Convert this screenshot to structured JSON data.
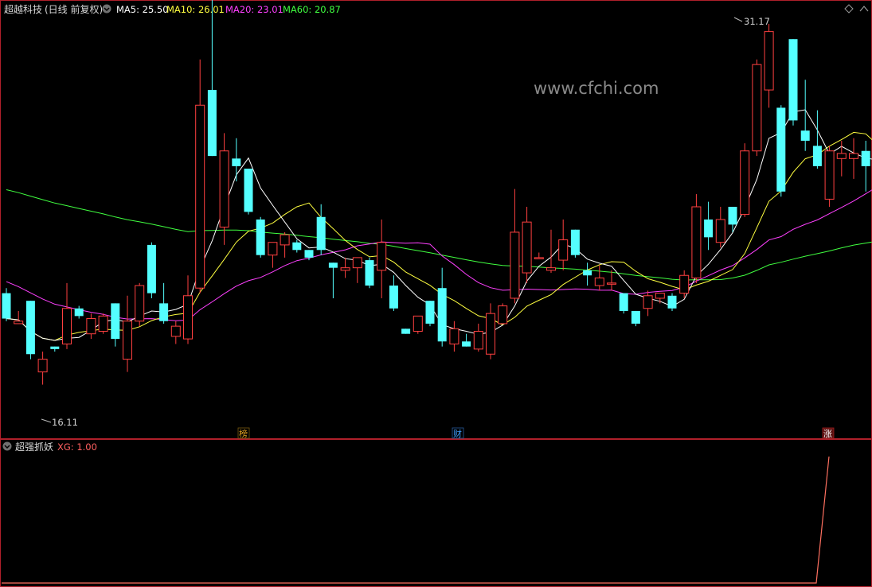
{
  "main_panel": {
    "stock_name": "超越科技",
    "period_label": "(日线 前复权)",
    "indicators": [
      {
        "label": "MA5: 25.50",
        "color": "#ffffff"
      },
      {
        "label": "MA10: 26.01",
        "color": "#ffff40"
      },
      {
        "label": "MA20: 23.01",
        "color": "#ff40ff"
      },
      {
        "label": "MA60: 20.87",
        "color": "#40ff40"
      }
    ],
    "watermark": "www.cfchi.com",
    "high_marker": "31.17",
    "low_marker": "16.11",
    "event_tags": [
      {
        "label": "榜",
        "color": "#e0a020"
      },
      {
        "label": "财",
        "color": "#40a0ff"
      },
      {
        "label": "涨",
        "color": "#ff4040"
      }
    ]
  },
  "sub_panel": {
    "name": "超强抓妖",
    "indicator": "XG: 1.00",
    "indicator_color": "#ff6060"
  },
  "colors": {
    "up": "#ff4040",
    "down": "#54ffff",
    "border": "#b0202a",
    "ma5": "#ffffff",
    "ma10": "#ffff40",
    "ma20": "#ff40ff",
    "ma60": "#40ff40"
  },
  "chart_data": {
    "type": "candlestick",
    "ohlc": [
      [
        20.6,
        20.8,
        19.5,
        19.6
      ],
      [
        19.4,
        19.9,
        19.4,
        19.5
      ],
      [
        20.3,
        20.3,
        18.0,
        18.2
      ],
      [
        17.5,
        18.3,
        17.0,
        18.0
      ],
      [
        18.5,
        18.5,
        18.3,
        18.4
      ],
      [
        18.6,
        21.0,
        18.4,
        20.0
      ],
      [
        20.0,
        20.1,
        19.6,
        19.7
      ],
      [
        19.0,
        19.8,
        18.8,
        19.6
      ],
      [
        19.1,
        19.8,
        19.0,
        19.7
      ],
      [
        20.2,
        20.2,
        18.5,
        18.8
      ],
      [
        18.0,
        20.5,
        17.5,
        19.5
      ],
      [
        19.5,
        21.0,
        19.3,
        20.9
      ],
      [
        22.5,
        22.6,
        20.4,
        20.6
      ],
      [
        20.2,
        21.0,
        19.4,
        19.5
      ],
      [
        18.9,
        19.5,
        18.6,
        19.3
      ],
      [
        18.8,
        21.3,
        18.6,
        20.5
      ],
      [
        20.8,
        29.8,
        20.6,
        28.0
      ],
      [
        28.6,
        32.2,
        26.0,
        26.0
      ],
      [
        23.2,
        26.9,
        22.5,
        26.2
      ],
      [
        25.9,
        26.7,
        25.0,
        25.6
      ],
      [
        25.5,
        25.5,
        23.7,
        23.8
      ],
      [
        23.5,
        23.6,
        22.0,
        22.1
      ],
      [
        22.1,
        22.6,
        21.6,
        22.6
      ],
      [
        22.5,
        23.0,
        22.0,
        22.9
      ],
      [
        22.6,
        22.7,
        22.2,
        22.3
      ],
      [
        22.3,
        22.3,
        21.9,
        22.0
      ],
      [
        23.6,
        24.1,
        22.1,
        22.3
      ],
      [
        21.8,
        21.8,
        20.4,
        21.6
      ],
      [
        21.5,
        22.0,
        21.2,
        21.6
      ],
      [
        21.6,
        22.0,
        21.0,
        22.0
      ],
      [
        21.9,
        22.0,
        20.8,
        20.9
      ],
      [
        21.5,
        23.5,
        20.4,
        22.6
      ],
      [
        20.9,
        21.3,
        19.9,
        20.0
      ],
      [
        19.2,
        19.2,
        19.0,
        19.0
      ],
      [
        19.1,
        19.7,
        19.0,
        19.7
      ],
      [
        20.3,
        20.3,
        19.3,
        19.4
      ],
      [
        20.8,
        21.6,
        18.5,
        18.7
      ],
      [
        18.6,
        19.5,
        18.3,
        19.2
      ],
      [
        18.7,
        19.0,
        18.5,
        18.5
      ],
      [
        18.4,
        19.4,
        18.3,
        19.1
      ],
      [
        18.2,
        20.2,
        18.0,
        19.8
      ],
      [
        19.4,
        20.2,
        19.4,
        20.1
      ],
      [
        20.4,
        24.7,
        20.2,
        23.0
      ],
      [
        21.4,
        24.0,
        21.0,
        23.4
      ],
      [
        22.0,
        22.2,
        22.0,
        22.0
      ],
      [
        21.5,
        23.1,
        21.4,
        21.6
      ],
      [
        21.9,
        23.5,
        21.5,
        22.7
      ],
      [
        23.1,
        23.1,
        22.0,
        22.1
      ],
      [
        21.5,
        21.8,
        20.9,
        21.3
      ],
      [
        20.9,
        21.7,
        20.7,
        21.2
      ],
      [
        21.0,
        21.5,
        20.7,
        21.0
      ],
      [
        20.6,
        20.6,
        19.8,
        19.9
      ],
      [
        19.9,
        19.9,
        19.3,
        19.4
      ],
      [
        20.0,
        20.7,
        19.7,
        20.5
      ],
      [
        20.4,
        20.6,
        20.2,
        20.6
      ],
      [
        20.5,
        20.6,
        19.9,
        20.0
      ],
      [
        20.6,
        21.5,
        20.4,
        21.3
      ],
      [
        21.2,
        24.5,
        21.0,
        24.0
      ],
      [
        23.5,
        24.2,
        22.3,
        22.8
      ],
      [
        22.6,
        24.0,
        22.4,
        23.5
      ],
      [
        24.0,
        24.0,
        23.0,
        23.3
      ],
      [
        23.7,
        26.5,
        23.6,
        26.2
      ],
      [
        26.2,
        29.8,
        26.0,
        29.6
      ],
      [
        28.6,
        31.2,
        27.9,
        30.9
      ],
      [
        27.9,
        28.0,
        24.4,
        24.6
      ],
      [
        30.6,
        30.6,
        27.2,
        27.4
      ],
      [
        27.0,
        29.0,
        26.2,
        26.6
      ],
      [
        26.4,
        27.8,
        25.5,
        25.6
      ],
      [
        24.3,
        26.4,
        24.0,
        26.2
      ],
      [
        25.9,
        26.6,
        25.2,
        26.1
      ],
      [
        25.9,
        26.7,
        25.1,
        26.1
      ],
      [
        26.2,
        26.6,
        24.6,
        25.6
      ],
      [
        26.0,
        27.0,
        25.6,
        25.2
      ],
      [
        27.5,
        31.8,
        27.4,
        31.5
      ]
    ]
  }
}
